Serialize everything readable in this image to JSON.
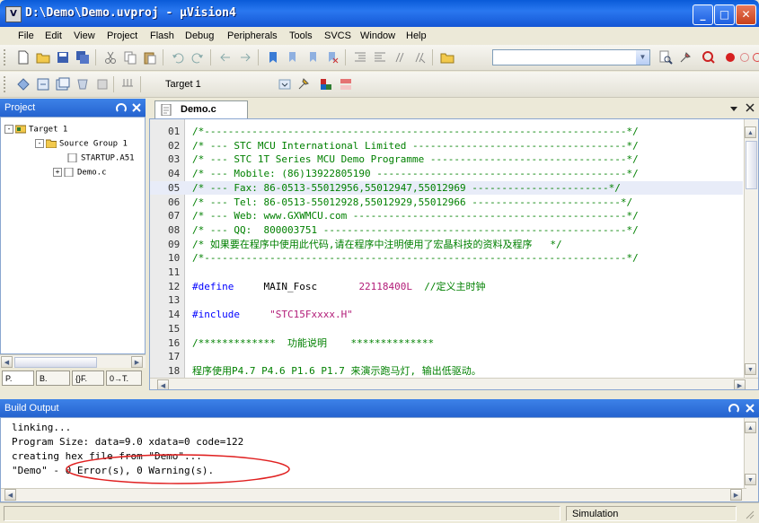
{
  "window": {
    "title": "D:\\Demo\\Demo.uvproj - µVision4",
    "app_icon": "V",
    "controls": {
      "minimize": "_",
      "maximize": "□",
      "close": "✕"
    }
  },
  "menu": [
    "File",
    "Edit",
    "View",
    "Project",
    "Flash",
    "Debug",
    "Peripherals",
    "Tools",
    "SVCS",
    "Window",
    "Help"
  ],
  "build_toolbar": {
    "target_label": "Target 1"
  },
  "project": {
    "title": "Project",
    "tree": [
      {
        "label": "Target 1",
        "level": 0,
        "expander": "-",
        "icon": "target-icon"
      },
      {
        "label": "Source Group 1",
        "level": 1,
        "expander": "-",
        "icon": "folder-icon"
      },
      {
        "label": "STARTUP.A51",
        "level": 2,
        "expander": "",
        "icon": "file-icon"
      },
      {
        "label": "Demo.c",
        "level": 2,
        "expander": "+",
        "icon": "file-icon"
      }
    ],
    "tabs": [
      "P.",
      "B.",
      "{}F.",
      "0→T."
    ]
  },
  "editor": {
    "tab_label": "Demo.c",
    "highlighted_line": 5,
    "lines": [
      {
        "num": "01",
        "text": "/*-----------------------------------------------------------------------*/"
      },
      {
        "num": "02",
        "text": "/* --- STC MCU International Limited ------------------------------------*/"
      },
      {
        "num": "03",
        "text": "/* --- STC 1T Series MCU Demo Programme ---------------------------------*/"
      },
      {
        "num": "04",
        "text": "/* --- Mobile: (86)13922805190 ------------------------------------------*/"
      },
      {
        "num": "05",
        "text": "/* --- Fax: 86-0513-55012956,55012947,55012969 -----------------------*/"
      },
      {
        "num": "06",
        "text": "/* --- Tel: 86-0513-55012928,55012929,55012966 -------------------------*/"
      },
      {
        "num": "07",
        "text": "/* --- Web: www.GXWMCU.com ----------------------------------------------*/"
      },
      {
        "num": "08",
        "text": "/* --- QQ:  800003751 ---------------------------------------------------*/"
      },
      {
        "num": "09",
        "text": "/* 如果要在程序中使用此代码,请在程序中注明使用了宏晶科技的资料及程序   */"
      },
      {
        "num": "10",
        "text": "/*-----------------------------------------------------------------------*/"
      },
      {
        "num": "11",
        "text": ""
      },
      {
        "num": "12",
        "kw": "#define",
        "rest": "     MAIN_Fosc       ",
        "val": "22118400L",
        "cmt": "  //定义主时钟"
      },
      {
        "num": "13",
        "text": ""
      },
      {
        "num": "14",
        "kw": "#include",
        "rest": "     ",
        "val": "\"STC15Fxxxx.H\"",
        "cmt": ""
      },
      {
        "num": "15",
        "text": ""
      },
      {
        "num": "16",
        "text": "/*************  功能说明    **************"
      },
      {
        "num": "17",
        "text": ""
      },
      {
        "num": "18",
        "text": "程序使用P4.7 P4.6 P1.6 P1.7 来演示跑马灯, 输出低驱动。"
      }
    ]
  },
  "build_output": {
    "title": "Build Output",
    "lines": [
      "linking...",
      "Program Size: data=9.0 xdata=0 code=122",
      "creating hex file from \"Demo\"...",
      "\"Demo\" - 0 Error(s), 0 Warning(s)."
    ]
  },
  "status": {
    "mode": "Simulation"
  },
  "colors": {
    "titlebar": "#1455d4",
    "panel_header": "#2563cf",
    "comment": "#008000",
    "keyword": "#0000ff",
    "string": "#b21c78",
    "annotation": "#e02020"
  }
}
